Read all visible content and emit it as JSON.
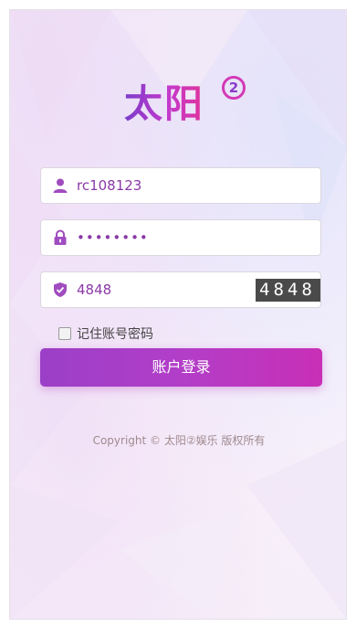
{
  "logo": {
    "text": "太阳",
    "badge": "2"
  },
  "form": {
    "username": {
      "icon": "user-icon",
      "value": "rc108123"
    },
    "password": {
      "icon": "lock-icon",
      "value": "••••••••"
    },
    "captcha": {
      "icon": "shield-icon",
      "value": "4848",
      "image_text": "4848"
    },
    "remember_label": "记住账号密码",
    "remember_checked": false,
    "submit_label": "账户登录"
  },
  "footer": {
    "copyright": "Copyright © 太阳②娱乐 版权所有"
  },
  "colors": {
    "accent": "#b23ec8",
    "icon": "#a04cbf",
    "input_text": "#8a3aa6"
  }
}
